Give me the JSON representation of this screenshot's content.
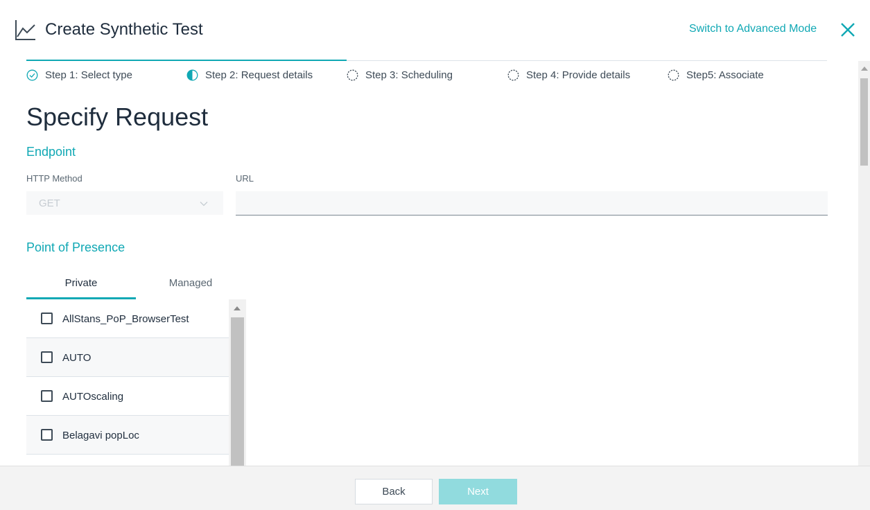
{
  "header": {
    "title": "Create Synthetic Test",
    "switch_mode": "Switch to Advanced Mode"
  },
  "steps": [
    {
      "label": "Step 1: Select type",
      "state": "complete"
    },
    {
      "label": "Step 2: Request details",
      "state": "current"
    },
    {
      "label": "Step 3: Scheduling",
      "state": "pending"
    },
    {
      "label": "Step 4: Provide details",
      "state": "pending"
    },
    {
      "label": "Step5: Associate",
      "state": "pending"
    }
  ],
  "page": {
    "title": "Specify Request"
  },
  "endpoint": {
    "heading": "Endpoint",
    "method_label": "HTTP Method",
    "method_value": "GET",
    "url_label": "URL",
    "url_value": ""
  },
  "pop": {
    "heading": "Point of Presence",
    "tabs": [
      "Private",
      "Managed"
    ],
    "items": [
      "AllStans_PoP_BrowserTest",
      "AUTO",
      "AUTOscaling",
      "Belagavi popLoc"
    ]
  },
  "footer": {
    "back": "Back",
    "next": "Next"
  },
  "colors": {
    "accent": "#10a8b4",
    "next_disabled": "#91dbde"
  }
}
